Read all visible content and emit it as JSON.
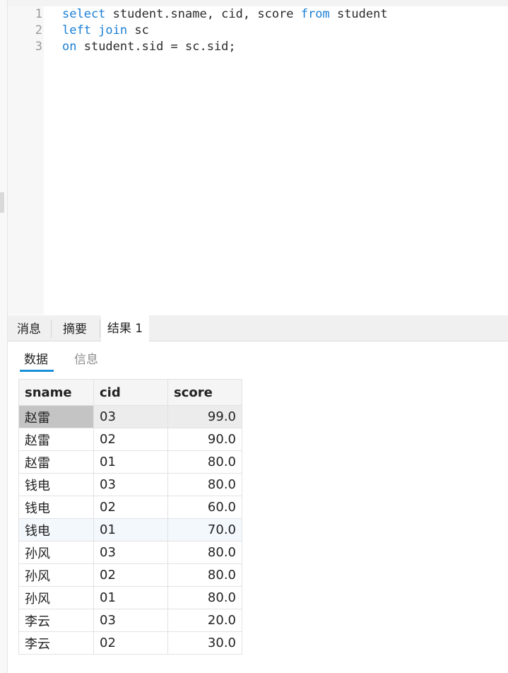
{
  "editor": {
    "lines": [
      {
        "num": "1",
        "tokens": [
          {
            "t": "select",
            "kw": true
          },
          {
            "t": " student.sname, cid, score ",
            "kw": false
          },
          {
            "t": "from",
            "kw": true
          },
          {
            "t": " student",
            "kw": false
          }
        ]
      },
      {
        "num": "2",
        "tokens": [
          {
            "t": "left join",
            "kw": true
          },
          {
            "t": " sc",
            "kw": false
          }
        ]
      },
      {
        "num": "3",
        "tokens": [
          {
            "t": "on",
            "kw": true
          },
          {
            "t": " student.sid = sc.sid;",
            "kw": false
          }
        ]
      }
    ]
  },
  "result_tabs": [
    "消息",
    "摘要",
    "结果 1"
  ],
  "active_result_tab": "结果 1",
  "sub_tabs": [
    "数据",
    "信息"
  ],
  "active_sub_tab": "数据",
  "table": {
    "columns": [
      "sname",
      "cid",
      "score"
    ],
    "rows": [
      [
        "赵雷",
        "03",
        "99.0"
      ],
      [
        "赵雷",
        "02",
        "90.0"
      ],
      [
        "赵雷",
        "01",
        "80.0"
      ],
      [
        "钱电",
        "03",
        "80.0"
      ],
      [
        "钱电",
        "02",
        "60.0"
      ],
      [
        "钱电",
        "01",
        "70.0"
      ],
      [
        "孙风",
        "03",
        "80.0"
      ],
      [
        "孙风",
        "02",
        "80.0"
      ],
      [
        "孙风",
        "01",
        "80.0"
      ],
      [
        "李云",
        "03",
        "20.0"
      ],
      [
        "李云",
        "02",
        "30.0"
      ]
    ]
  },
  "colors": {
    "keyword": "#1a7fd6",
    "accent_underline": "#1a90d9"
  }
}
